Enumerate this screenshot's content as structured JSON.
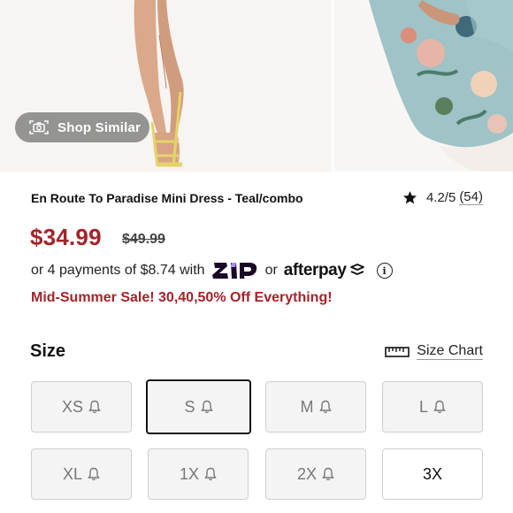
{
  "gallery": {
    "shop_similar_label": "Shop Similar"
  },
  "product": {
    "title": "En Route To Paradise Mini Dress - Teal/combo",
    "rating": "4.2/5",
    "rating_count": "(54)",
    "price": "$34.99",
    "original_price": "$49.99",
    "payments_prefix": "or 4 payments of $8.74 with",
    "payments_or": "or",
    "afterpay_label": "afterpay",
    "sale_text": "Mid-Summer Sale! 30,40,50% Off Everything!"
  },
  "size": {
    "heading": "Size",
    "chart_label": "Size Chart",
    "options": [
      "XS",
      "S",
      "M",
      "L",
      "XL",
      "1X",
      "2X",
      "3X"
    ]
  },
  "colors": {
    "price_red": "#a2242a",
    "zip_purple": "#1a0826"
  }
}
